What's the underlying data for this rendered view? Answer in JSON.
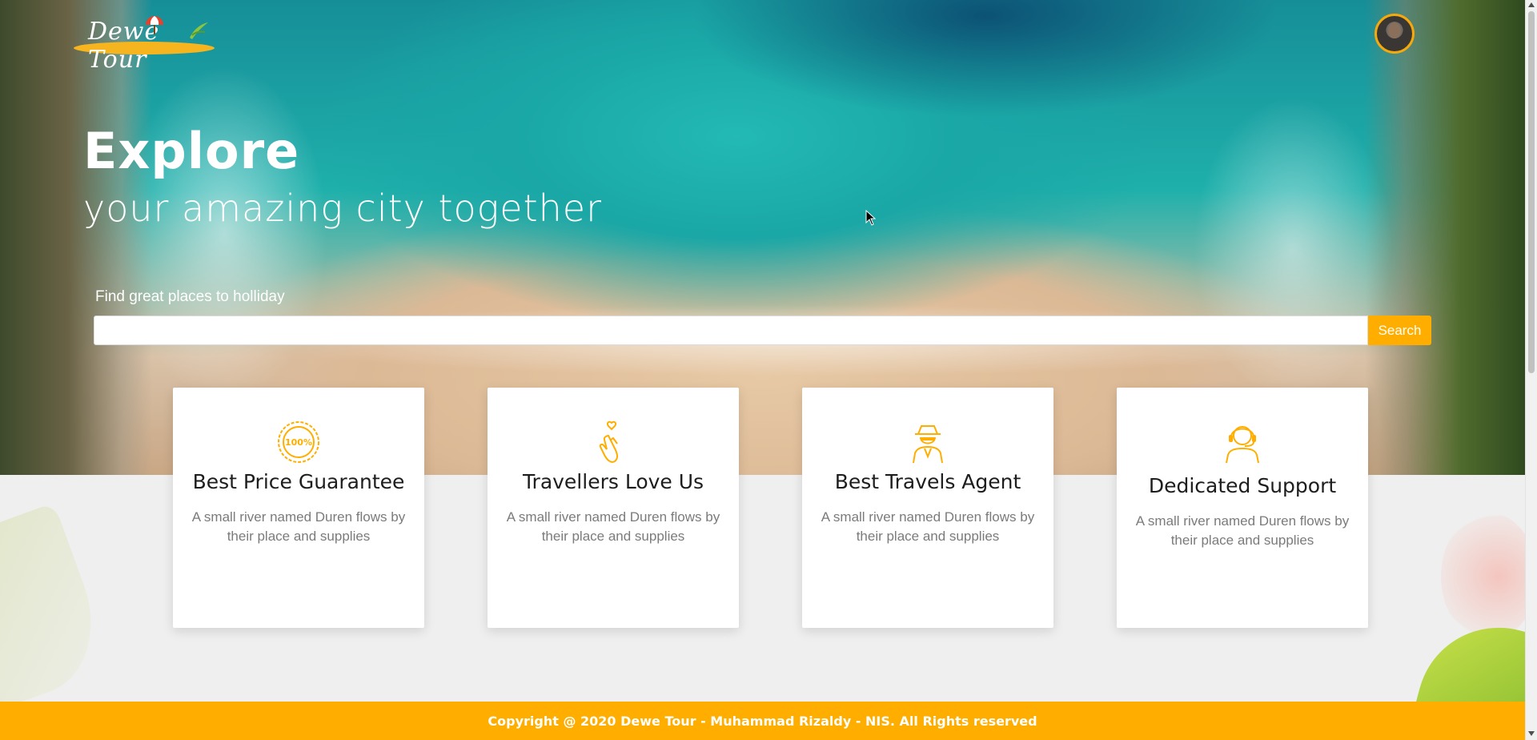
{
  "brand": {
    "logo_text": "Dewe Tour",
    "accent_color": "#ffae00"
  },
  "hero": {
    "headline": "Explore",
    "subheadline": "your amazing city together"
  },
  "search": {
    "label": "Find great places to holliday",
    "placeholder": "",
    "button_label": "Search"
  },
  "cards": [
    {
      "icon": "100-percent-badge-icon",
      "title": "Best Price Guarantee",
      "description": "A small river named Duren flows by their place and supplies"
    },
    {
      "icon": "finger-heart-icon",
      "title": "Travellers Love Us",
      "description": "A small river named Duren flows by their place and supplies"
    },
    {
      "icon": "agent-icon",
      "title": "Best Travels Agent",
      "description": "A small river named Duren flows by their place and supplies"
    },
    {
      "icon": "headset-support-icon",
      "title": "Dedicated Support",
      "description": "A small river named Duren flows by their place and supplies"
    }
  ],
  "footer": {
    "copyright": "Copyright @ 2020 Dewe Tour - Muhammad Rizaldy - NIS. All Rights reserved"
  }
}
